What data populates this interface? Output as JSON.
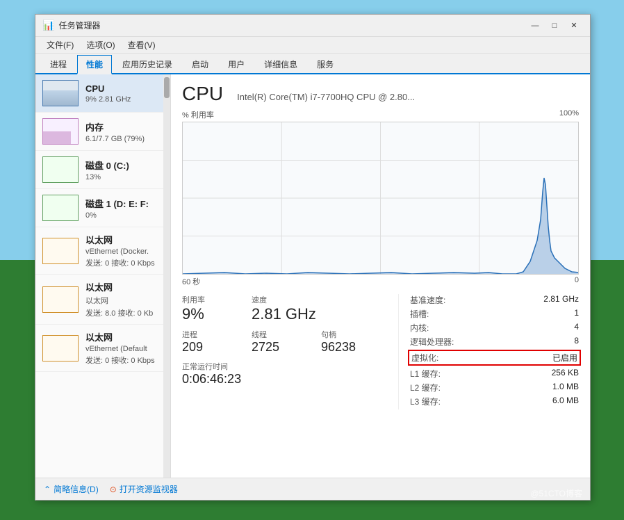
{
  "window": {
    "title": "任务管理器",
    "icon": "📊"
  },
  "titlebar": {
    "minimize": "—",
    "maximize": "□",
    "close": "✕"
  },
  "menu": {
    "items": [
      "文件(F)",
      "选项(O)",
      "查看(V)"
    ]
  },
  "tabs": [
    {
      "label": "进程",
      "active": false
    },
    {
      "label": "性能",
      "active": true
    },
    {
      "label": "应用历史记录",
      "active": false
    },
    {
      "label": "启动",
      "active": false
    },
    {
      "label": "用户",
      "active": false
    },
    {
      "label": "详细信息",
      "active": false
    },
    {
      "label": "服务",
      "active": false
    }
  ],
  "sidebar": {
    "items": [
      {
        "id": "cpu",
        "label": "CPU",
        "value1": "9% 2.81 GHz",
        "active": true,
        "border_color": "#4a7ab0"
      },
      {
        "id": "memory",
        "label": "内存",
        "value1": "6.1/7.7 GB (79%)",
        "active": false,
        "border_color": "#c080c0"
      },
      {
        "id": "disk0",
        "label": "磁盘 0 (C:)",
        "value1": "13%",
        "active": false,
        "border_color": "#60a060"
      },
      {
        "id": "disk1",
        "label": "磁盘 1 (D: E: F:",
        "value1": "0%",
        "active": false,
        "border_color": "#60a060"
      },
      {
        "id": "eth1",
        "label": "以太网",
        "value1": "vEthernet (Docker.",
        "value2": "发送: 0 接收: 0 Kbps",
        "active": false,
        "border_color": "#d0902a"
      },
      {
        "id": "eth2",
        "label": "以太网",
        "value1": "以太网",
        "value2": "发送: 8.0 接收: 0 Kb",
        "active": false,
        "border_color": "#d0902a"
      },
      {
        "id": "eth3",
        "label": "以太网",
        "value1": "vEthernet (Default",
        "value2": "发送: 0 接收: 0 Kbps",
        "active": false,
        "border_color": "#d0902a"
      }
    ]
  },
  "cpu_panel": {
    "title": "CPU",
    "model": "Intel(R) Core(TM) i7-7700HQ CPU @ 2.80...",
    "chart": {
      "y_label": "% 利用率",
      "y_max": "100%",
      "x_start": "60 秒",
      "x_end": "0"
    },
    "stats": {
      "utilization_label": "利用率",
      "utilization_value": "9%",
      "speed_label": "速度",
      "speed_value": "2.81 GHz",
      "processes_label": "进程",
      "processes_value": "209",
      "threads_label": "线程",
      "threads_value": "2725",
      "handles_label": "句柄",
      "handles_value": "96238",
      "uptime_label": "正常运行时间",
      "uptime_value": "0:06:46:23"
    },
    "details": {
      "base_speed_label": "基准速度:",
      "base_speed_value": "2.81 GHz",
      "sockets_label": "插槽:",
      "sockets_value": "1",
      "cores_label": "内核:",
      "cores_value": "4",
      "logical_label": "逻辑处理器:",
      "logical_value": "8",
      "virtualization_label": "虚拟化:",
      "virtualization_value": "已启用",
      "l1_label": "L1 缓存:",
      "l1_value": "256 KB",
      "l2_label": "L2 缓存:",
      "l2_value": "1.0 MB",
      "l3_label": "L3 缓存:",
      "l3_value": "6.0 MB"
    }
  },
  "bottom": {
    "brief_info": "简略信息(D)",
    "open_monitor": "打开资源监视器",
    "watermark": "@51CTO博客"
  }
}
